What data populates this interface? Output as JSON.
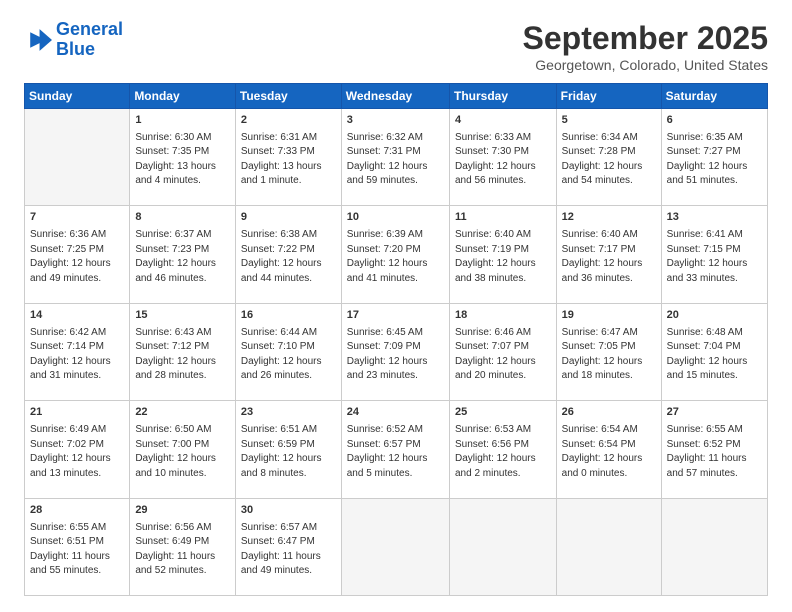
{
  "logo": {
    "line1": "General",
    "line2": "Blue"
  },
  "title": "September 2025",
  "location": "Georgetown, Colorado, United States",
  "days_of_week": [
    "Sunday",
    "Monday",
    "Tuesday",
    "Wednesday",
    "Thursday",
    "Friday",
    "Saturday"
  ],
  "weeks": [
    [
      {
        "day": "",
        "content": ""
      },
      {
        "day": "1",
        "content": "Sunrise: 6:30 AM\nSunset: 7:35 PM\nDaylight: 13 hours\nand 4 minutes."
      },
      {
        "day": "2",
        "content": "Sunrise: 6:31 AM\nSunset: 7:33 PM\nDaylight: 13 hours\nand 1 minute."
      },
      {
        "day": "3",
        "content": "Sunrise: 6:32 AM\nSunset: 7:31 PM\nDaylight: 12 hours\nand 59 minutes."
      },
      {
        "day": "4",
        "content": "Sunrise: 6:33 AM\nSunset: 7:30 PM\nDaylight: 12 hours\nand 56 minutes."
      },
      {
        "day": "5",
        "content": "Sunrise: 6:34 AM\nSunset: 7:28 PM\nDaylight: 12 hours\nand 54 minutes."
      },
      {
        "day": "6",
        "content": "Sunrise: 6:35 AM\nSunset: 7:27 PM\nDaylight: 12 hours\nand 51 minutes."
      }
    ],
    [
      {
        "day": "7",
        "content": "Sunrise: 6:36 AM\nSunset: 7:25 PM\nDaylight: 12 hours\nand 49 minutes."
      },
      {
        "day": "8",
        "content": "Sunrise: 6:37 AM\nSunset: 7:23 PM\nDaylight: 12 hours\nand 46 minutes."
      },
      {
        "day": "9",
        "content": "Sunrise: 6:38 AM\nSunset: 7:22 PM\nDaylight: 12 hours\nand 44 minutes."
      },
      {
        "day": "10",
        "content": "Sunrise: 6:39 AM\nSunset: 7:20 PM\nDaylight: 12 hours\nand 41 minutes."
      },
      {
        "day": "11",
        "content": "Sunrise: 6:40 AM\nSunset: 7:19 PM\nDaylight: 12 hours\nand 38 minutes."
      },
      {
        "day": "12",
        "content": "Sunrise: 6:40 AM\nSunset: 7:17 PM\nDaylight: 12 hours\nand 36 minutes."
      },
      {
        "day": "13",
        "content": "Sunrise: 6:41 AM\nSunset: 7:15 PM\nDaylight: 12 hours\nand 33 minutes."
      }
    ],
    [
      {
        "day": "14",
        "content": "Sunrise: 6:42 AM\nSunset: 7:14 PM\nDaylight: 12 hours\nand 31 minutes."
      },
      {
        "day": "15",
        "content": "Sunrise: 6:43 AM\nSunset: 7:12 PM\nDaylight: 12 hours\nand 28 minutes."
      },
      {
        "day": "16",
        "content": "Sunrise: 6:44 AM\nSunset: 7:10 PM\nDaylight: 12 hours\nand 26 minutes."
      },
      {
        "day": "17",
        "content": "Sunrise: 6:45 AM\nSunset: 7:09 PM\nDaylight: 12 hours\nand 23 minutes."
      },
      {
        "day": "18",
        "content": "Sunrise: 6:46 AM\nSunset: 7:07 PM\nDaylight: 12 hours\nand 20 minutes."
      },
      {
        "day": "19",
        "content": "Sunrise: 6:47 AM\nSunset: 7:05 PM\nDaylight: 12 hours\nand 18 minutes."
      },
      {
        "day": "20",
        "content": "Sunrise: 6:48 AM\nSunset: 7:04 PM\nDaylight: 12 hours\nand 15 minutes."
      }
    ],
    [
      {
        "day": "21",
        "content": "Sunrise: 6:49 AM\nSunset: 7:02 PM\nDaylight: 12 hours\nand 13 minutes."
      },
      {
        "day": "22",
        "content": "Sunrise: 6:50 AM\nSunset: 7:00 PM\nDaylight: 12 hours\nand 10 minutes."
      },
      {
        "day": "23",
        "content": "Sunrise: 6:51 AM\nSunset: 6:59 PM\nDaylight: 12 hours\nand 8 minutes."
      },
      {
        "day": "24",
        "content": "Sunrise: 6:52 AM\nSunset: 6:57 PM\nDaylight: 12 hours\nand 5 minutes."
      },
      {
        "day": "25",
        "content": "Sunrise: 6:53 AM\nSunset: 6:56 PM\nDaylight: 12 hours\nand 2 minutes."
      },
      {
        "day": "26",
        "content": "Sunrise: 6:54 AM\nSunset: 6:54 PM\nDaylight: 12 hours\nand 0 minutes."
      },
      {
        "day": "27",
        "content": "Sunrise: 6:55 AM\nSunset: 6:52 PM\nDaylight: 11 hours\nand 57 minutes."
      }
    ],
    [
      {
        "day": "28",
        "content": "Sunrise: 6:55 AM\nSunset: 6:51 PM\nDaylight: 11 hours\nand 55 minutes."
      },
      {
        "day": "29",
        "content": "Sunrise: 6:56 AM\nSunset: 6:49 PM\nDaylight: 11 hours\nand 52 minutes."
      },
      {
        "day": "30",
        "content": "Sunrise: 6:57 AM\nSunset: 6:47 PM\nDaylight: 11 hours\nand 49 minutes."
      },
      {
        "day": "",
        "content": ""
      },
      {
        "day": "",
        "content": ""
      },
      {
        "day": "",
        "content": ""
      },
      {
        "day": "",
        "content": ""
      }
    ]
  ]
}
